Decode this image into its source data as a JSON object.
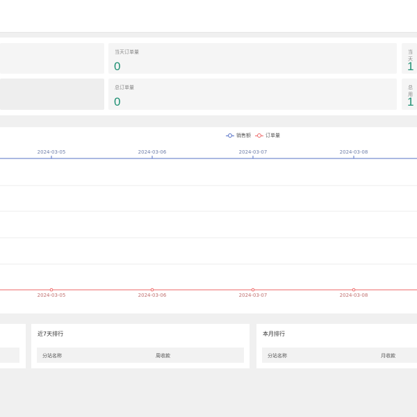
{
  "stats": {
    "today_orders_label": "当天订单量",
    "today_orders_value": "0",
    "total_orders_label": "总订单量",
    "total_orders_value": "0",
    "right_top_label": "当天",
    "right_top_value": "1",
    "right_bottom_label": "总用",
    "right_bottom_value": "1"
  },
  "chart": {
    "legend": [
      {
        "label": "销售额",
        "color": "#5470c6"
      },
      {
        "label": "订单量",
        "color": "#ee6666"
      }
    ]
  },
  "chart_data": {
    "type": "line",
    "categories": [
      "2024-03-05",
      "2024-03-06",
      "2024-03-07",
      "2024-03-08"
    ],
    "series": [
      {
        "name": "销售额",
        "values": [
          0,
          0,
          0,
          0
        ],
        "color": "#5470c6"
      },
      {
        "name": "订单量",
        "values": [
          0,
          0,
          0,
          0
        ],
        "color": "#ee6666"
      }
    ],
    "grid": true,
    "legend_position": "top"
  },
  "ranking": {
    "week": {
      "title": "近7天排行",
      "col1": "分站名称",
      "col2": "周收款"
    },
    "month": {
      "title": "本月排行",
      "col1": "分站名称",
      "col2": "月收款"
    }
  }
}
